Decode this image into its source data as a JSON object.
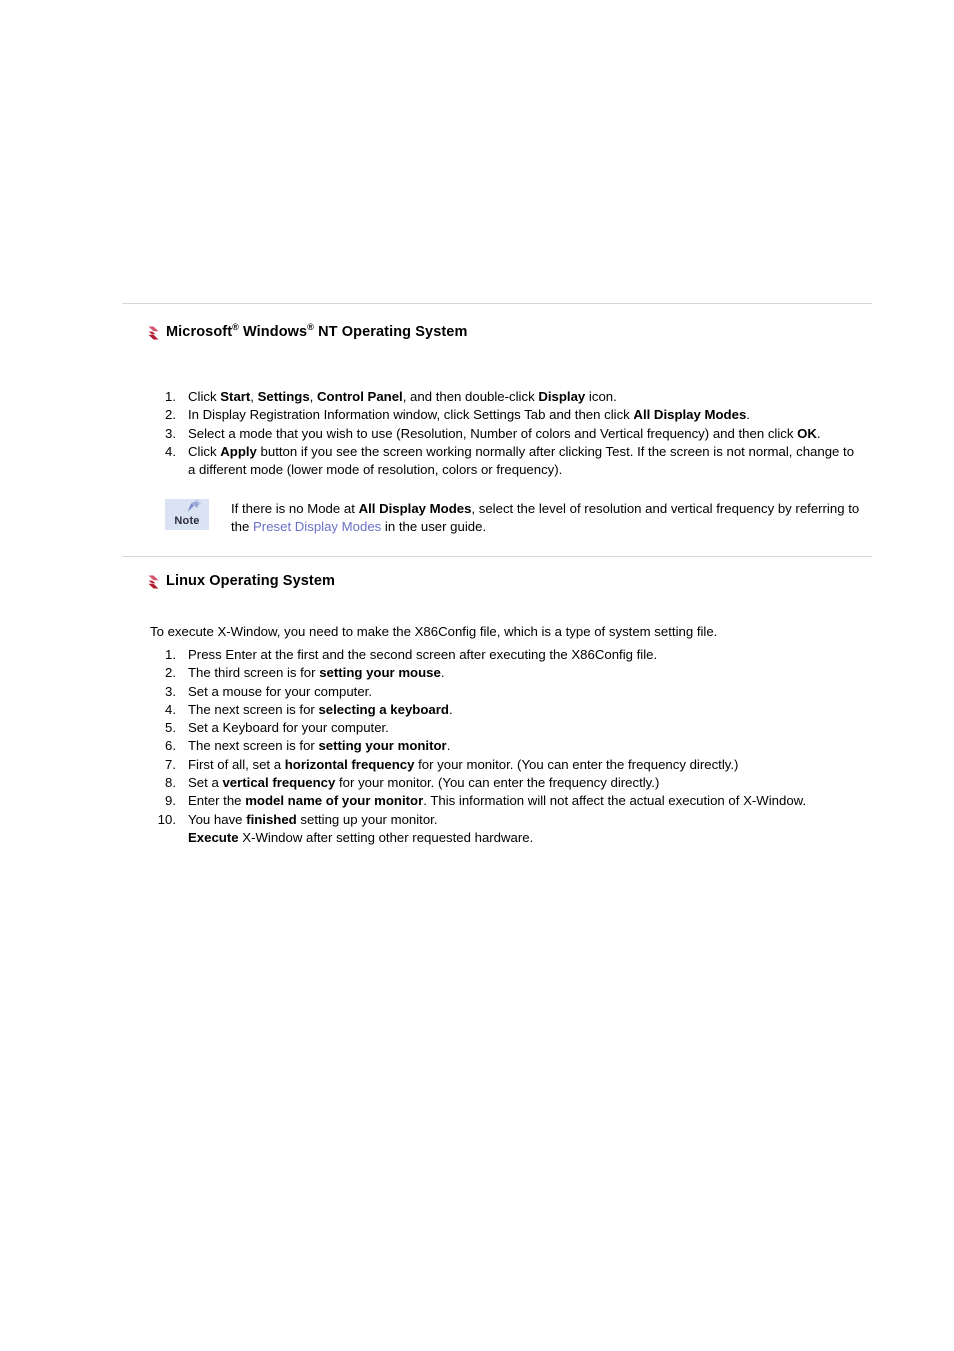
{
  "page": {
    "background": "#ffffff",
    "link_color": "#6a70c8",
    "bullet_color": "#b01c2e",
    "rule_color": "#d6d6d6"
  },
  "sections": {
    "windows": {
      "bullet_icon": "red-arrow-bullet-icon",
      "heading_prefix": "Microsoft",
      "heading_sup1": "®",
      "heading_middle": " Windows",
      "heading_sup2": "®",
      "heading_suffix": " NT Operating System",
      "heading_plain": "Microsoft® Windows® NT Operating System",
      "items": [
        {
          "num": "1.",
          "parts": [
            {
              "t": "Click ",
              "b": false
            },
            {
              "t": "Start",
              "b": true
            },
            {
              "t": ", ",
              "b": false
            },
            {
              "t": "Settings",
              "b": true
            },
            {
              "t": ", ",
              "b": false
            },
            {
              "t": "Control Panel",
              "b": true
            },
            {
              "t": ", and then double-click ",
              "b": false
            },
            {
              "t": "Display",
              "b": true
            },
            {
              "t": " icon.",
              "b": false
            }
          ]
        },
        {
          "num": "2.",
          "parts": [
            {
              "t": "In Display Registration Information window, click Settings Tab and then click ",
              "b": false
            },
            {
              "t": "All Display Modes",
              "b": true
            },
            {
              "t": ".",
              "b": false
            }
          ]
        },
        {
          "num": "3.",
          "parts": [
            {
              "t": "Select a mode that you wish to use (Resolution, Number of colors and Vertical frequency) and then click ",
              "b": false
            },
            {
              "t": "OK",
              "b": true
            },
            {
              "t": ".",
              "b": false
            }
          ]
        },
        {
          "num": "4.",
          "parts": [
            {
              "t": "Click ",
              "b": false
            },
            {
              "t": "Apply",
              "b": true
            },
            {
              "t": " button if you see the screen working normally after clicking Test. If the screen is not normal, change to a different mode (lower mode of resolution, colors or frequency).",
              "b": false
            }
          ]
        }
      ],
      "note": {
        "icon_name": "note-pushpin-icon",
        "icon_label": "Note",
        "parts": [
          {
            "t": "If there is no Mode at ",
            "b": false
          },
          {
            "t": "All Display Modes",
            "b": true
          },
          {
            "t": ", select the level of resolution and vertical frequency by referring to the ",
            "b": false
          },
          {
            "t": "Preset Display Modes",
            "b": false,
            "link": true
          },
          {
            "t": " in the user guide.",
            "b": false
          }
        ]
      }
    },
    "linux": {
      "bullet_icon": "red-arrow-bullet-icon",
      "heading_plain": "Linux Operating System",
      "intro": "To execute X-Window, you need to make the X86Config file, which is a type of system setting file.",
      "items": [
        {
          "num": "1.",
          "parts": [
            {
              "t": "Press Enter at the first and the second screen after executing the X86Config file.",
              "b": false
            }
          ]
        },
        {
          "num": "2.",
          "parts": [
            {
              "t": "The third screen is for ",
              "b": false
            },
            {
              "t": "setting your mouse",
              "b": true
            },
            {
              "t": ".",
              "b": false
            }
          ]
        },
        {
          "num": "3.",
          "parts": [
            {
              "t": "Set a mouse for your computer.",
              "b": false
            }
          ]
        },
        {
          "num": "4.",
          "parts": [
            {
              "t": "The next screen is for ",
              "b": false
            },
            {
              "t": "selecting a keyboard",
              "b": true
            },
            {
              "t": ".",
              "b": false
            }
          ]
        },
        {
          "num": "5.",
          "parts": [
            {
              "t": "Set a Keyboard for your computer.",
              "b": false
            }
          ]
        },
        {
          "num": "6.",
          "parts": [
            {
              "t": "The next screen is for ",
              "b": false
            },
            {
              "t": "setting your monitor",
              "b": true
            },
            {
              "t": ".",
              "b": false
            }
          ]
        },
        {
          "num": "7.",
          "parts": [
            {
              "t": "First of all, set a ",
              "b": false
            },
            {
              "t": "horizontal frequency",
              "b": true
            },
            {
              "t": " for your monitor. (You can enter the frequency directly.)",
              "b": false
            }
          ]
        },
        {
          "num": "8.",
          "parts": [
            {
              "t": "Set a ",
              "b": false
            },
            {
              "t": "vertical frequency",
              "b": true
            },
            {
              "t": " for your monitor. (You can enter the frequency directly.)",
              "b": false
            }
          ]
        },
        {
          "num": "9.",
          "parts": [
            {
              "t": "Enter the ",
              "b": false
            },
            {
              "t": "model name of your monitor",
              "b": true
            },
            {
              "t": ". This information will not affect the actual execution of X-Window.",
              "b": false
            }
          ]
        },
        {
          "num": "10.",
          "parts": [
            {
              "t": "You have ",
              "b": false
            },
            {
              "t": "finished",
              "b": true
            },
            {
              "t": " setting up your monitor.",
              "b": false
            },
            {
              "t": "\n",
              "b": false,
              "br": true
            },
            {
              "t": "Execute",
              "b": true
            },
            {
              "t": " X-Window after setting other requested hardware.",
              "b": false
            }
          ]
        }
      ]
    }
  }
}
